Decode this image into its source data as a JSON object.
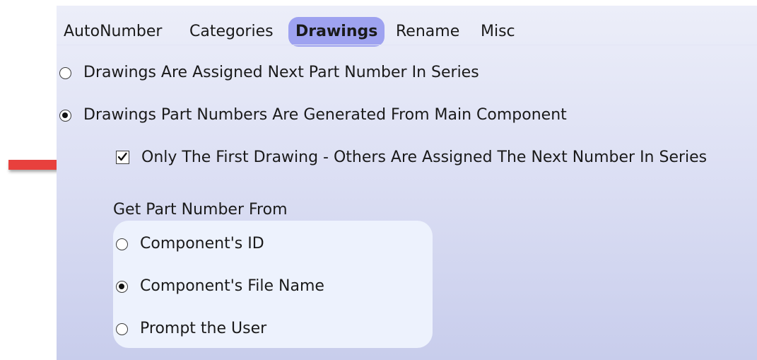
{
  "tabs": [
    {
      "label": "AutoNumber",
      "active": false
    },
    {
      "label": "Categories",
      "active": false
    },
    {
      "label": "Drawings",
      "active": true
    },
    {
      "label": "Rename",
      "active": false
    },
    {
      "label": "Misc",
      "active": false
    }
  ],
  "drawing_options": {
    "assign_next": {
      "label": "Drawings Are Assigned Next Part Number In Series",
      "selected": false
    },
    "generate_from_main": {
      "label": "Drawings Part Numbers Are Generated From Main Component",
      "selected": true
    },
    "only_first": {
      "label": "Only The First Drawing - Others Are Assigned The Next Number In Series",
      "checked": true
    }
  },
  "get_part_number": {
    "heading": "Get Part Number From",
    "options": [
      {
        "label": "Component's ID",
        "selected": false
      },
      {
        "label": "Component's File Name",
        "selected": true
      },
      {
        "label": "Prompt the User",
        "selected": false
      }
    ]
  },
  "colors": {
    "active_tab": "#9ea2f0",
    "arrow": "#e8413c",
    "group_box": "#edf2fd"
  },
  "annotation_icon": "red-arrow-icon"
}
